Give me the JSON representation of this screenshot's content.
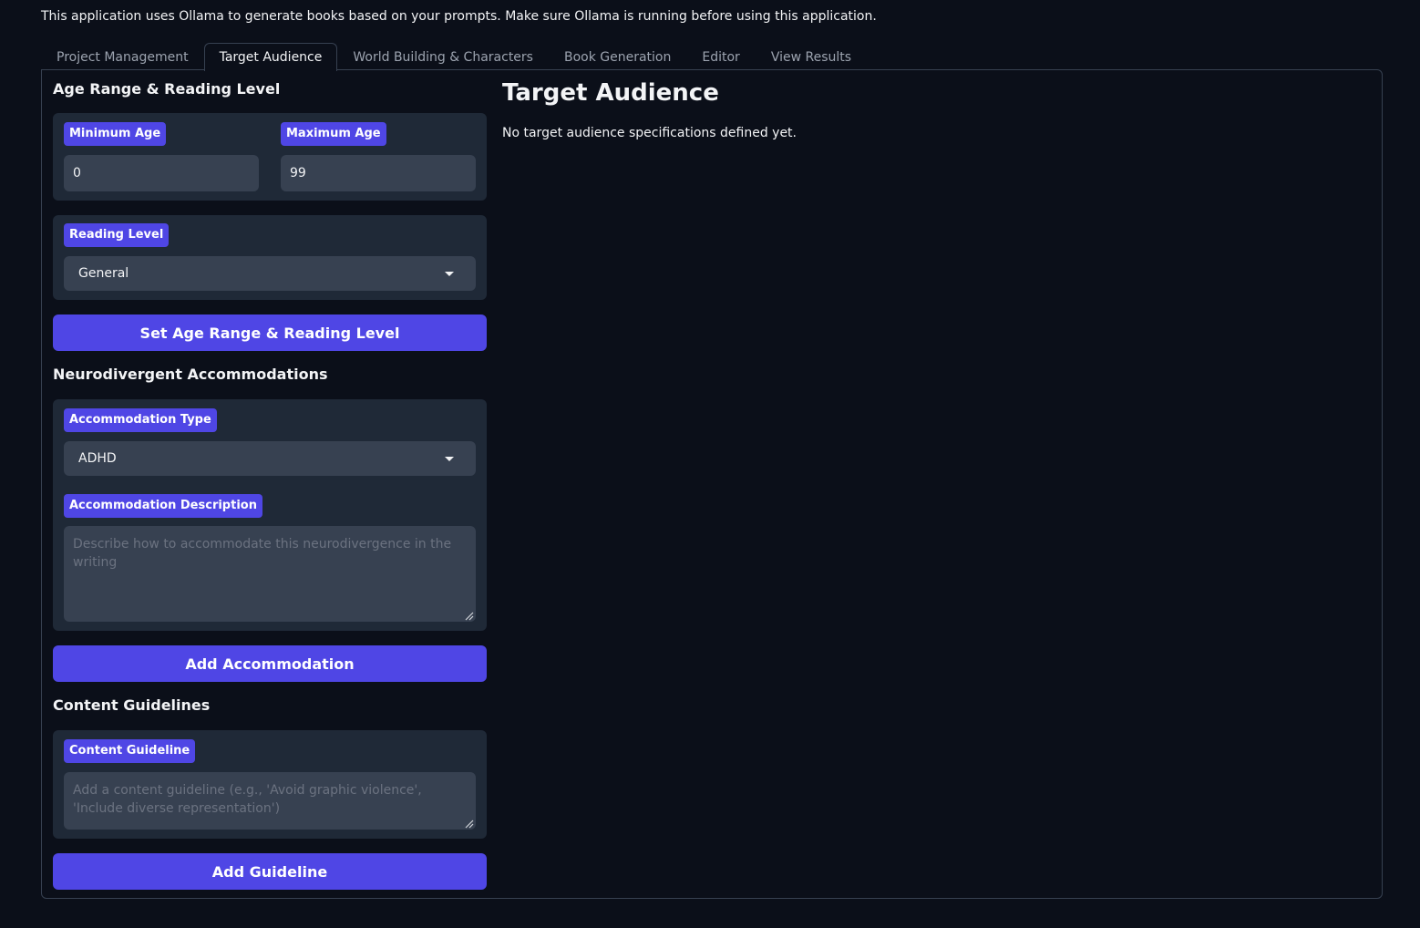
{
  "intro_text": "This application uses Ollama to generate books based on your prompts. Make sure Ollama is running before using this application.",
  "tabs": [
    {
      "label": "Project Management",
      "active": false
    },
    {
      "label": "Target Audience",
      "active": true
    },
    {
      "label": "World Building & Characters",
      "active": false
    },
    {
      "label": "Book Generation",
      "active": false
    },
    {
      "label": "Editor",
      "active": false
    },
    {
      "label": "View Results",
      "active": false
    }
  ],
  "age_section": {
    "title": "Age Range & Reading Level",
    "min_age_label": "Minimum Age",
    "min_age_value": "0",
    "max_age_label": "Maximum Age",
    "max_age_value": "99",
    "reading_level_label": "Reading Level",
    "reading_level_value": "General",
    "submit_label": "Set Age Range & Reading Level"
  },
  "accommodation_section": {
    "title": "Neurodivergent Accommodations",
    "type_label": "Accommodation Type",
    "type_value": "ADHD",
    "description_label": "Accommodation Description",
    "description_placeholder": "Describe how to accommodate this neurodivergence in the writing",
    "submit_label": "Add Accommodation"
  },
  "guidelines_section": {
    "title": "Content Guidelines",
    "guideline_label": "Content Guideline",
    "guideline_placeholder": "Add a content guideline (e.g., 'Avoid graphic violence', 'Include diverse representation')",
    "submit_label": "Add Guideline"
  },
  "output": {
    "heading": "Target Audience",
    "message": "No target audience specifications defined yet."
  },
  "colors": {
    "background": "#0b0f19",
    "block": "#1f2937",
    "input": "#374151",
    "accent": "#4f46e5"
  }
}
